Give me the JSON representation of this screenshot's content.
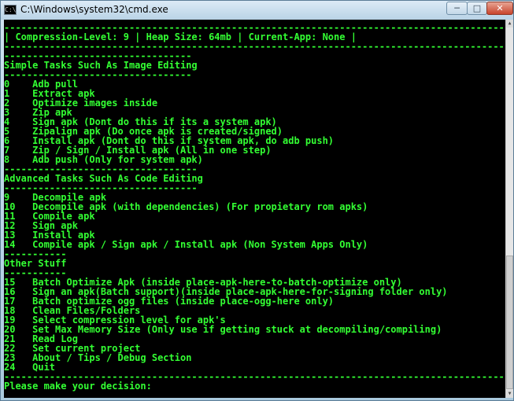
{
  "window": {
    "title": "C:\\Windows\\system32\\cmd.exe",
    "icon": "cmd-app-icon",
    "icon_glyph": "C:\\",
    "controls": {
      "minimize": "─",
      "maximize": "□",
      "close": "✕"
    }
  },
  "colors": {
    "text": "#33ff33",
    "background": "#000000"
  },
  "console": {
    "lines": [
      "----------------------------------------------------------------------------------------------",
      "| Compression-Level: 9 | Heap Size: 64mb | Current-App: None |",
      "----------------------------------------------------------------------------------------------",
      "---------------------------------",
      "Simple Tasks Such As Image Editing",
      "---------------------------------",
      "0    Adb pull",
      "1    Extract apk",
      "2    Optimize images inside",
      "3    Zip apk",
      "4    Sign apk (Dont do this if its a system apk)",
      "5    Zipalign apk (Do once apk is created/signed)",
      "6    Install apk (Dont do this if system apk, do adb push)",
      "7    Zip / Sign / Install apk (All in one step)",
      "8    Adb push (Only for system apk)",
      "----------------------------------",
      "Advanced Tasks Such As Code Editing",
      "----------------------------------",
      "9    Decompile apk",
      "10   Decompile apk (with dependencies) (For propietary rom apks)",
      "11   Compile apk",
      "12   Sign apk",
      "13   Install apk",
      "14   Compile apk / Sign apk / Install apk (Non System Apps Only)",
      "-----------",
      "Other Stuff",
      "-----------",
      "15   Batch Optimize Apk (inside place-apk-here-to-batch-optimize only)",
      "16   Sign an apk(Batch support)(inside place-apk-here-for-signing folder only)",
      "17   Batch optimize ogg files (inside place-ogg-here only)",
      "18   Clean Files/Folders",
      "19   Select compression level for apk's",
      "20   Set Max Memory Size (Only use if getting stuck at decompiling/compiling)",
      "21   Read Log",
      "22   Set current project",
      "23   About / Tips / Debug Section",
      "24   Quit",
      "----------------------------------------------------------------------------------------------",
      "Please make your decision:"
    ]
  }
}
